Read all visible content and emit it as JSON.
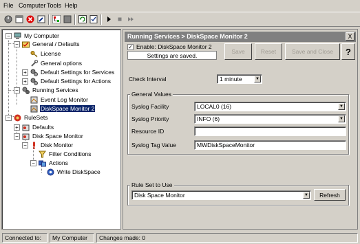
{
  "menu": {
    "file": "File",
    "computer": "Computer",
    "tools": "Tools",
    "help": "Help"
  },
  "toolbar": {
    "icons": [
      "power-icon",
      "sheet-icon",
      "stop-icon",
      "wrench-icon",
      "tree-icon",
      "gray-square-icon",
      "refresh-icon",
      "sheet-check-icon",
      "play-icon",
      "stop-square-icon",
      "next-icon"
    ]
  },
  "tree": {
    "root": "My Computer",
    "general_defaults": "General / Defaults",
    "license": "License",
    "general_options": "General options",
    "default_settings_services": "Default Settings for Services",
    "default_settings_actions": "Default Settings for Actions",
    "running_services": "Running Services",
    "event_log_monitor": "Event Log Monitor",
    "diskspace_monitor_2": "DiskSpace Monitor 2",
    "rulesets": "RuleSets",
    "defaults": "Defaults",
    "disk_space_monitor": "Disk Space Monitor",
    "disk_monitor": "Disk Monitor",
    "filter_conditions": "Filter Conditions",
    "actions": "Actions",
    "write_diskspace": "Write DiskSpace"
  },
  "panel": {
    "title": "Running Services > DiskSpace Monitor 2",
    "close": "X",
    "enable_label": "Enable: DiskSpace Monitor 2",
    "enable_checked": "✓",
    "status": "Settings are saved.",
    "save": "Save",
    "reset": "Reset",
    "save_close": "Save and Close",
    "help": "?",
    "check_interval_label": "Check Interval",
    "check_interval_value": "1 minute",
    "general_values_title": "General Values",
    "syslog_facility_label": "Syslog Facility",
    "syslog_facility_value": "LOCAL0 (16)",
    "syslog_priority_label": "Syslog Priority",
    "syslog_priority_value": "INFO (6)",
    "resource_id_label": "Resource ID",
    "resource_id_value": "",
    "syslog_tag_label": "Syslog Tag Value",
    "syslog_tag_value": "MWDiskSpaceMonitor",
    "ruleset_title": "Rule Set to Use",
    "ruleset_value": "Disk Space Monitor",
    "refresh": "Refresh"
  },
  "status_bar": {
    "connected_label": "Connected to:",
    "connected_value": "My Computer",
    "changes": "Changes made: 0"
  },
  "colors": {
    "selection": "#0a246a",
    "title_bar": "#808080",
    "face": "#d4d0c8"
  }
}
